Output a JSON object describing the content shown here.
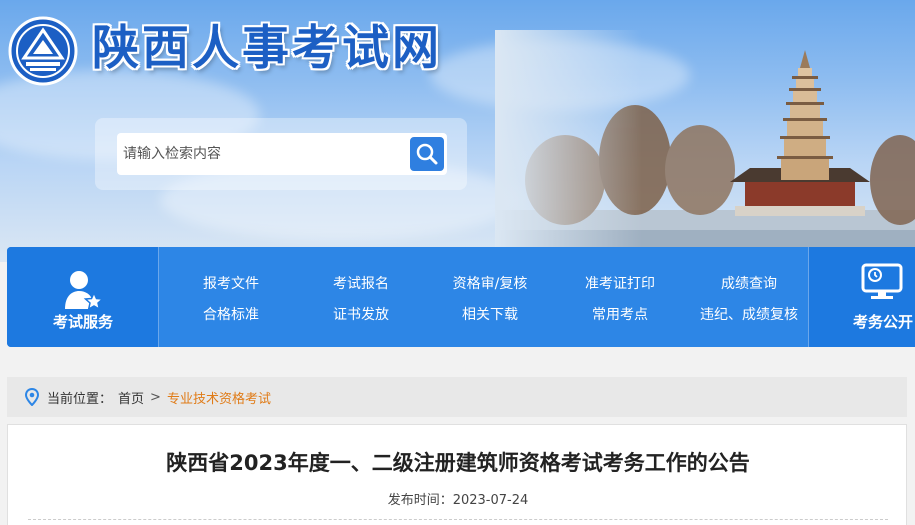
{
  "header": {
    "site_title": "陕西人事考试网",
    "search": {
      "placeholder": "请输入检索内容"
    }
  },
  "nav": {
    "left_label": "考试服务",
    "right_label": "考务公开",
    "links": [
      "报考文件",
      "考试报名",
      "资格审/复核",
      "准考证打印",
      "成绩查询",
      "合格标准",
      "证书发放",
      "相关下载",
      "常用考点",
      "违纪、成绩复核"
    ]
  },
  "breadcrumb": {
    "prefix": "当前位置：",
    "home": "首页",
    "separator": ">",
    "current": "专业技术资格考试"
  },
  "article": {
    "title": "陕西省2023年度一、二级注册建筑师资格考试考务工作的公告",
    "date_label": "发布时间：",
    "date": "2023-07-24"
  },
  "colors": {
    "accent": "#2d86e6",
    "title_blue": "#1c5fc4",
    "breadcrumb_current": "#e07b17"
  }
}
